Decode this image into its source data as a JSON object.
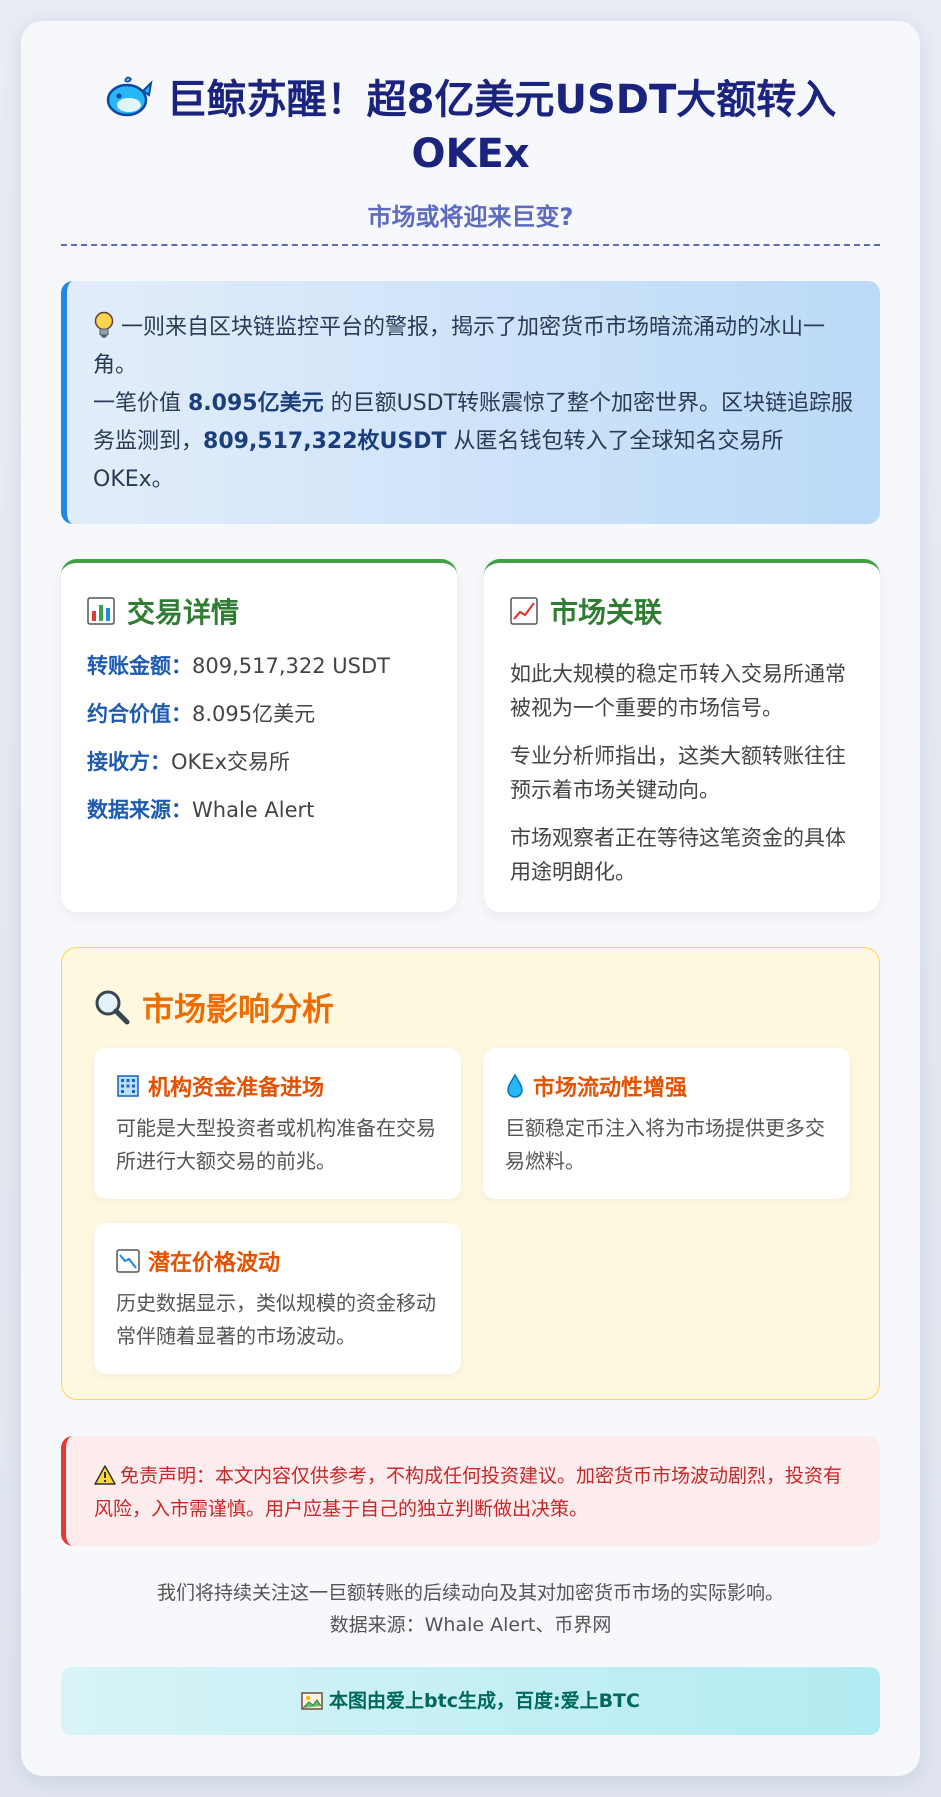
{
  "header": {
    "title": "巨鲸苏醒！超8亿美元USDT大额转入OKEx",
    "subtitle": "市场或将迎来巨变?"
  },
  "intro": {
    "line1": "一则来自区块链监控平台的警报，揭示了加密货币市场暗流涌动的冰山一角。",
    "p2_pre": "一笔价值 ",
    "p2_value": "8.095亿美元",
    "p2_mid": " 的巨额USDT转账震惊了整个加密世界。区块链追踪服务监测到，",
    "p2_amount": "809,517,322枚USDT",
    "p2_post": " 从匿名钱包转入了全球知名交易所OKEx。"
  },
  "details": {
    "title": "交易详情",
    "rows": [
      {
        "label": "转账金额：",
        "value": "809,517,322 USDT"
      },
      {
        "label": "约合价值：",
        "value": "8.095亿美元"
      },
      {
        "label": "接收方：",
        "value": "OKEx交易所"
      },
      {
        "label": "数据来源：",
        "value": "Whale Alert"
      }
    ]
  },
  "market": {
    "title": "市场关联",
    "paragraphs": [
      "如此大规模的稳定币转入交易所通常被视为一个重要的市场信号。",
      "专业分析师指出，这类大额转账往往预示着市场关键动向。",
      "市场观察者正在等待这笔资金的具体用途明朗化。"
    ]
  },
  "impact": {
    "title": "市场影响分析",
    "cards": [
      {
        "title": "机构资金准备进场",
        "desc": "可能是大型投资者或机构准备在交易所进行大额交易的前兆。"
      },
      {
        "title": "市场流动性增强",
        "desc": "巨额稳定币注入将为市场提供更多交易燃料。"
      },
      {
        "title": "潜在价格波动",
        "desc": "历史数据显示，类似规模的资金移动常伴随着显著的市场波动。"
      }
    ]
  },
  "disclaimer": "免责声明：本文内容仅供参考，不构成任何投资建议。加密货币市场波动剧烈，投资有风险，入市需谨慎。用户应基于自己的独立判断做出决策。",
  "footer": {
    "line1": "我们将持续关注这一巨额转账的后续动向及其对加密货币市场的实际影响。",
    "line2": "数据来源：Whale Alert、币界网"
  },
  "credit": "本图由爱上btc生成，百度:爱上BTC",
  "colors": {
    "title": "#1a237e",
    "subtitle": "#5c6bc0",
    "panel_accent": "#43a047",
    "impact_accent": "#ef6c00",
    "disclaimer": "#c62828"
  },
  "icons": {
    "title": "whale-icon",
    "intro": "lightbulb-icon",
    "details": "bar-chart-icon",
    "market": "trend-up-icon",
    "impact": "magnifier-icon",
    "impact_cards": [
      "office-building-icon",
      "droplet-icon",
      "trend-down-icon"
    ],
    "disclaimer": "warning-icon",
    "credit": "picture-icon"
  }
}
